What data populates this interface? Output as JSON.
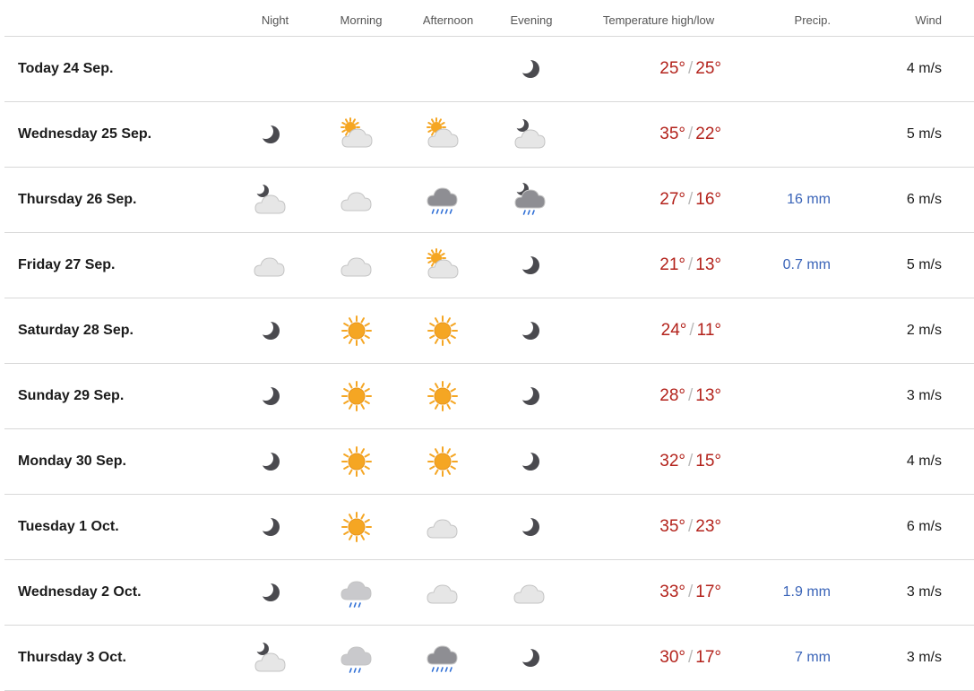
{
  "headers": {
    "night": "Night",
    "morning": "Morning",
    "afternoon": "Afternoon",
    "evening": "Evening",
    "temperature": "Temperature high/low",
    "precip": "Precip.",
    "wind": "Wind"
  },
  "temp_separator": "/",
  "colors": {
    "temperature": "#b3221b",
    "precipitation": "#3a64b8",
    "moon": "#4a4a4f",
    "sun": "#f5a623",
    "cloud": "#e6e6e6",
    "rain_cloud": "#8e8e93",
    "rain": "#2f6fd6"
  },
  "days": [
    {
      "label": "Today 24 Sep.",
      "night": null,
      "morning": null,
      "afternoon": null,
      "evening": "moon",
      "high": "25°",
      "low": "25°",
      "precip": "",
      "wind": "4 m/s"
    },
    {
      "label": "Wednesday 25 Sep.",
      "night": "moon",
      "morning": "sun-cloud",
      "afternoon": "sun-cloud",
      "evening": "moon-cloud",
      "high": "35°",
      "low": "22°",
      "precip": "",
      "wind": "5 m/s"
    },
    {
      "label": "Thursday 26 Sep.",
      "night": "moon-cloud",
      "morning": "cloud",
      "afternoon": "rain-cloud",
      "evening": "moon-rain-cloud",
      "high": "27°",
      "low": "16°",
      "precip": "16 mm",
      "wind": "6 m/s"
    },
    {
      "label": "Friday 27 Sep.",
      "night": "cloud",
      "morning": "cloud",
      "afternoon": "sun-cloud",
      "evening": "moon",
      "high": "21°",
      "low": "13°",
      "precip": "0.7 mm",
      "wind": "5 m/s"
    },
    {
      "label": "Saturday 28 Sep.",
      "night": "moon",
      "morning": "sun",
      "afternoon": "sun",
      "evening": "moon",
      "high": "24°",
      "low": "11°",
      "precip": "",
      "wind": "2 m/s"
    },
    {
      "label": "Sunday 29 Sep.",
      "night": "moon",
      "morning": "sun",
      "afternoon": "sun",
      "evening": "moon",
      "high": "28°",
      "low": "13°",
      "precip": "",
      "wind": "3 m/s"
    },
    {
      "label": "Monday 30 Sep.",
      "night": "moon",
      "morning": "sun",
      "afternoon": "sun",
      "evening": "moon",
      "high": "32°",
      "low": "15°",
      "precip": "",
      "wind": "4 m/s"
    },
    {
      "label": "Tuesday 1 Oct.",
      "night": "moon",
      "morning": "sun",
      "afternoon": "cloud",
      "evening": "moon",
      "high": "35°",
      "low": "23°",
      "precip": "",
      "wind": "6 m/s"
    },
    {
      "label": "Wednesday 2 Oct.",
      "night": "moon",
      "morning": "light-rain-cloud",
      "afternoon": "cloud",
      "evening": "cloud",
      "high": "33°",
      "low": "17°",
      "precip": "1.9 mm",
      "wind": "3 m/s"
    },
    {
      "label": "Thursday 3 Oct.",
      "night": "moon-cloud",
      "morning": "light-rain-cloud",
      "afternoon": "rain-cloud",
      "evening": "moon",
      "high": "30°",
      "low": "17°",
      "precip": "7 mm",
      "wind": "3 m/s"
    }
  ]
}
